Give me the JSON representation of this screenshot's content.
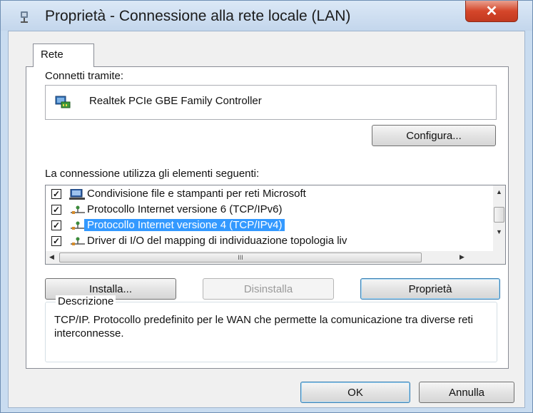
{
  "window": {
    "title": "Proprietà - Connessione alla rete locale (LAN)",
    "close_label": "✕"
  },
  "tabs": [
    {
      "label": "Rete"
    }
  ],
  "connect_via": {
    "label": "Connetti tramite:",
    "adapter_name": "Realtek PCIe GBE Family Controller",
    "configure_label": "Configura..."
  },
  "items_section": {
    "label": "La connessione utilizza gli elementi seguenti:",
    "items": [
      {
        "text": "Condivisione file e stampanti per reti Microsoft",
        "checked": true,
        "icon": "network-share-icon"
      },
      {
        "text": "Protocollo Internet versione 6 (TCP/IPv6)",
        "checked": true,
        "icon": "protocol-icon"
      },
      {
        "text": "Protocollo Internet versione 4 (TCP/IPv4)",
        "checked": true,
        "icon": "protocol-icon",
        "selected": true
      },
      {
        "text": "Driver di I/O del mapping di individuazione topologia liv",
        "checked": true,
        "icon": "protocol-icon"
      }
    ],
    "scroll_grip": "III"
  },
  "buttons": {
    "install": "Installa...",
    "uninstall": "Disinstalla",
    "properties": "Proprietà",
    "ok": "OK",
    "cancel": "Annulla"
  },
  "description": {
    "legend": "Descrizione",
    "text": "TCP/IP. Protocollo predefinito per le WAN che permette la comunicazione tra diverse reti interconnesse."
  },
  "colors": {
    "selection": "#3399ff",
    "close_button": "#d5462a"
  }
}
